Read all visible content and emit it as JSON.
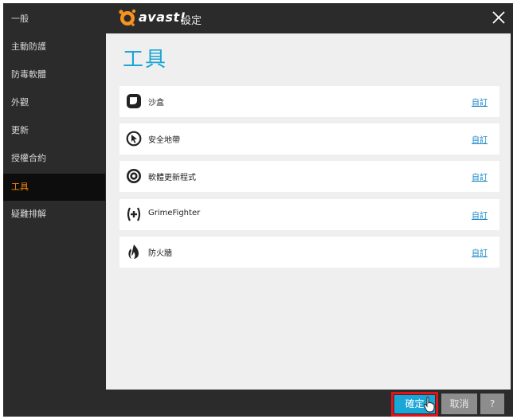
{
  "window": {
    "brand": "avast!",
    "title": "設定"
  },
  "sidebar": {
    "items": [
      {
        "label": "一般",
        "active": false
      },
      {
        "label": "主動防護",
        "active": false
      },
      {
        "label": "防毒軟體",
        "active": false
      },
      {
        "label": "外觀",
        "active": false
      },
      {
        "label": "更新",
        "active": false
      },
      {
        "label": "授權合約",
        "active": false
      },
      {
        "label": "工具",
        "active": true
      },
      {
        "label": "疑難排解",
        "active": false
      }
    ]
  },
  "main": {
    "title": "工具",
    "tools": [
      {
        "label": "沙盒",
        "icon": "sandbox-icon",
        "link": "自訂"
      },
      {
        "label": "安全地帶",
        "icon": "safezone-icon",
        "link": "自訂"
      },
      {
        "label": "軟體更新程式",
        "icon": "software-updater-icon",
        "link": "自訂"
      },
      {
        "label": "GrimeFighter",
        "icon": "grimefighter-icon",
        "link": "自訂"
      },
      {
        "label": "防火牆",
        "icon": "firewall-icon",
        "link": "自訂"
      }
    ]
  },
  "footer": {
    "ok_label": "確定",
    "cancel_label": "取消",
    "help_label": "?"
  },
  "colors": {
    "accent": "#1aa6d6",
    "active_nav": "#ff8a00",
    "highlight": "#e2141b"
  }
}
